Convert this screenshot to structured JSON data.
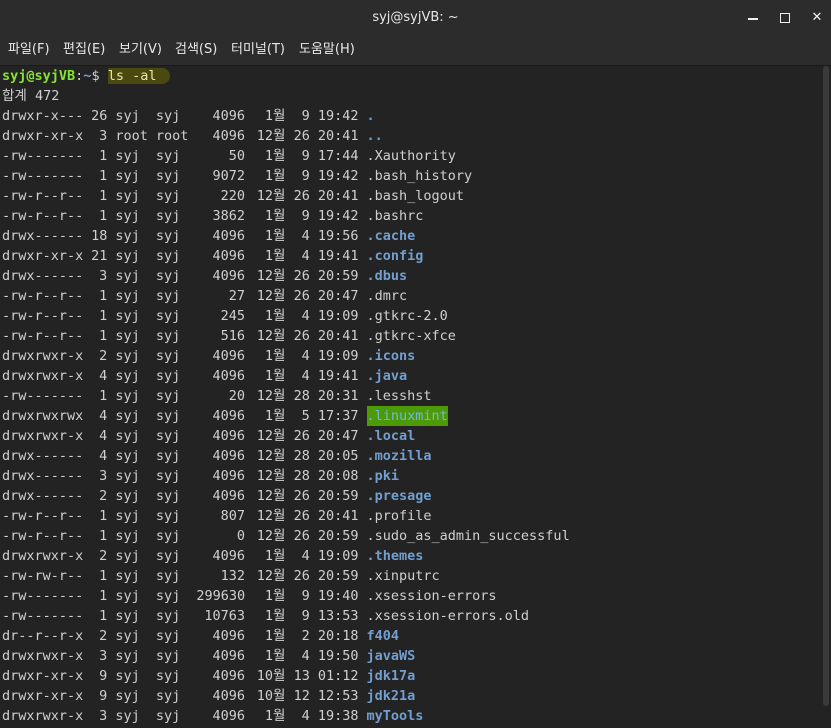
{
  "window": {
    "title": "syj@syjVB: ~"
  },
  "menu": [
    {
      "label": "파일(F)"
    },
    {
      "label": "편집(E)"
    },
    {
      "label": "보기(V)"
    },
    {
      "label": "검색(S)"
    },
    {
      "label": "터미널(T)"
    },
    {
      "label": "도움말(H)"
    }
  ],
  "prompt": {
    "user_host": "syj@syjVB",
    "sep": ":",
    "path": "~",
    "symbol": "$ ",
    "command": "ls -al"
  },
  "total_line": "합계 472",
  "colors": {
    "user": "#8ae234",
    "dir": "#729fcf",
    "other_writable_bg": "#4e9a06",
    "background": "#232323"
  },
  "entries": [
    {
      "perm": "drwxr-x---",
      "links": "26",
      "owner": "syj",
      "group": "syj",
      "size": "4096",
      "month": "1월",
      "day": "9",
      "time": "19:42",
      "name": ".",
      "kind": "dir"
    },
    {
      "perm": "drwxr-xr-x",
      "links": "3",
      "owner": "root",
      "group": "root",
      "size": "4096",
      "month": "12월",
      "day": "26",
      "time": "20:41",
      "name": "..",
      "kind": "dir"
    },
    {
      "perm": "-rw-------",
      "links": "1",
      "owner": "syj",
      "group": "syj",
      "size": "50",
      "month": "1월",
      "day": "9",
      "time": "17:44",
      "name": ".Xauthority",
      "kind": "file"
    },
    {
      "perm": "-rw-------",
      "links": "1",
      "owner": "syj",
      "group": "syj",
      "size": "9072",
      "month": "1월",
      "day": "9",
      "time": "19:42",
      "name": ".bash_history",
      "kind": "file"
    },
    {
      "perm": "-rw-r--r--",
      "links": "1",
      "owner": "syj",
      "group": "syj",
      "size": "220",
      "month": "12월",
      "day": "26",
      "time": "20:41",
      "name": ".bash_logout",
      "kind": "file"
    },
    {
      "perm": "-rw-r--r--",
      "links": "1",
      "owner": "syj",
      "group": "syj",
      "size": "3862",
      "month": "1월",
      "day": "9",
      "time": "19:42",
      "name": ".bashrc",
      "kind": "file"
    },
    {
      "perm": "drwx------",
      "links": "18",
      "owner": "syj",
      "group": "syj",
      "size": "4096",
      "month": "1월",
      "day": "4",
      "time": "19:56",
      "name": ".cache",
      "kind": "dir"
    },
    {
      "perm": "drwxr-xr-x",
      "links": "21",
      "owner": "syj",
      "group": "syj",
      "size": "4096",
      "month": "1월",
      "day": "4",
      "time": "19:41",
      "name": ".config",
      "kind": "dir"
    },
    {
      "perm": "drwx------",
      "links": "3",
      "owner": "syj",
      "group": "syj",
      "size": "4096",
      "month": "12월",
      "day": "26",
      "time": "20:59",
      "name": ".dbus",
      "kind": "dir"
    },
    {
      "perm": "-rw-r--r--",
      "links": "1",
      "owner": "syj",
      "group": "syj",
      "size": "27",
      "month": "12월",
      "day": "26",
      "time": "20:47",
      "name": ".dmrc",
      "kind": "file"
    },
    {
      "perm": "-rw-r--r--",
      "links": "1",
      "owner": "syj",
      "group": "syj",
      "size": "245",
      "month": "1월",
      "day": "4",
      "time": "19:09",
      "name": ".gtkrc-2.0",
      "kind": "file"
    },
    {
      "perm": "-rw-r--r--",
      "links": "1",
      "owner": "syj",
      "group": "syj",
      "size": "516",
      "month": "12월",
      "day": "26",
      "time": "20:41",
      "name": ".gtkrc-xfce",
      "kind": "file"
    },
    {
      "perm": "drwxrwxr-x",
      "links": "2",
      "owner": "syj",
      "group": "syj",
      "size": "4096",
      "month": "1월",
      "day": "4",
      "time": "19:09",
      "name": ".icons",
      "kind": "dir"
    },
    {
      "perm": "drwxrwxr-x",
      "links": "4",
      "owner": "syj",
      "group": "syj",
      "size": "4096",
      "month": "1월",
      "day": "4",
      "time": "19:41",
      "name": ".java",
      "kind": "dir"
    },
    {
      "perm": "-rw-------",
      "links": "1",
      "owner": "syj",
      "group": "syj",
      "size": "20",
      "month": "12월",
      "day": "28",
      "time": "20:31",
      "name": ".lesshst",
      "kind": "file"
    },
    {
      "perm": "drwxrwxrwx",
      "links": "4",
      "owner": "syj",
      "group": "syj",
      "size": "4096",
      "month": "1월",
      "day": "5",
      "time": "17:37",
      "name": ".linuxmint",
      "kind": "other-writable"
    },
    {
      "perm": "drwxrwxr-x",
      "links": "4",
      "owner": "syj",
      "group": "syj",
      "size": "4096",
      "month": "12월",
      "day": "26",
      "time": "20:47",
      "name": ".local",
      "kind": "dir"
    },
    {
      "perm": "drwx------",
      "links": "4",
      "owner": "syj",
      "group": "syj",
      "size": "4096",
      "month": "12월",
      "day": "28",
      "time": "20:05",
      "name": ".mozilla",
      "kind": "dir"
    },
    {
      "perm": "drwx------",
      "links": "3",
      "owner": "syj",
      "group": "syj",
      "size": "4096",
      "month": "12월",
      "day": "28",
      "time": "20:08",
      "name": ".pki",
      "kind": "dir"
    },
    {
      "perm": "drwx------",
      "links": "2",
      "owner": "syj",
      "group": "syj",
      "size": "4096",
      "month": "12월",
      "day": "26",
      "time": "20:59",
      "name": ".presage",
      "kind": "dir"
    },
    {
      "perm": "-rw-r--r--",
      "links": "1",
      "owner": "syj",
      "group": "syj",
      "size": "807",
      "month": "12월",
      "day": "26",
      "time": "20:41",
      "name": ".profile",
      "kind": "file"
    },
    {
      "perm": "-rw-r--r--",
      "links": "1",
      "owner": "syj",
      "group": "syj",
      "size": "0",
      "month": "12월",
      "day": "26",
      "time": "20:59",
      "name": ".sudo_as_admin_successful",
      "kind": "file"
    },
    {
      "perm": "drwxrwxr-x",
      "links": "2",
      "owner": "syj",
      "group": "syj",
      "size": "4096",
      "month": "1월",
      "day": "4",
      "time": "19:09",
      "name": ".themes",
      "kind": "dir"
    },
    {
      "perm": "-rw-rw-r--",
      "links": "1",
      "owner": "syj",
      "group": "syj",
      "size": "132",
      "month": "12월",
      "day": "26",
      "time": "20:59",
      "name": ".xinputrc",
      "kind": "file"
    },
    {
      "perm": "-rw-------",
      "links": "1",
      "owner": "syj",
      "group": "syj",
      "size": "299630",
      "month": "1월",
      "day": "9",
      "time": "19:40",
      "name": ".xsession-errors",
      "kind": "file"
    },
    {
      "perm": "-rw-------",
      "links": "1",
      "owner": "syj",
      "group": "syj",
      "size": "10763",
      "month": "1월",
      "day": "9",
      "time": "13:53",
      "name": ".xsession-errors.old",
      "kind": "file"
    },
    {
      "perm": "dr--r--r-x",
      "links": "2",
      "owner": "syj",
      "group": "syj",
      "size": "4096",
      "month": "1월",
      "day": "2",
      "time": "20:18",
      "name": "f404",
      "kind": "dir"
    },
    {
      "perm": "drwxrwxr-x",
      "links": "3",
      "owner": "syj",
      "group": "syj",
      "size": "4096",
      "month": "1월",
      "day": "4",
      "time": "19:50",
      "name": "javaWS",
      "kind": "dir"
    },
    {
      "perm": "drwxr-xr-x",
      "links": "9",
      "owner": "syj",
      "group": "syj",
      "size": "4096",
      "month": "10월",
      "day": "13",
      "time": "01:12",
      "name": "jdk17a",
      "kind": "dir"
    },
    {
      "perm": "drwxr-xr-x",
      "links": "9",
      "owner": "syj",
      "group": "syj",
      "size": "4096",
      "month": "10월",
      "day": "12",
      "time": "12:53",
      "name": "jdk21a",
      "kind": "dir"
    },
    {
      "perm": "drwxrwxr-x",
      "links": "3",
      "owner": "syj",
      "group": "syj",
      "size": "4096",
      "month": "1월",
      "day": "4",
      "time": "19:38",
      "name": "myTools",
      "kind": "dir"
    }
  ]
}
